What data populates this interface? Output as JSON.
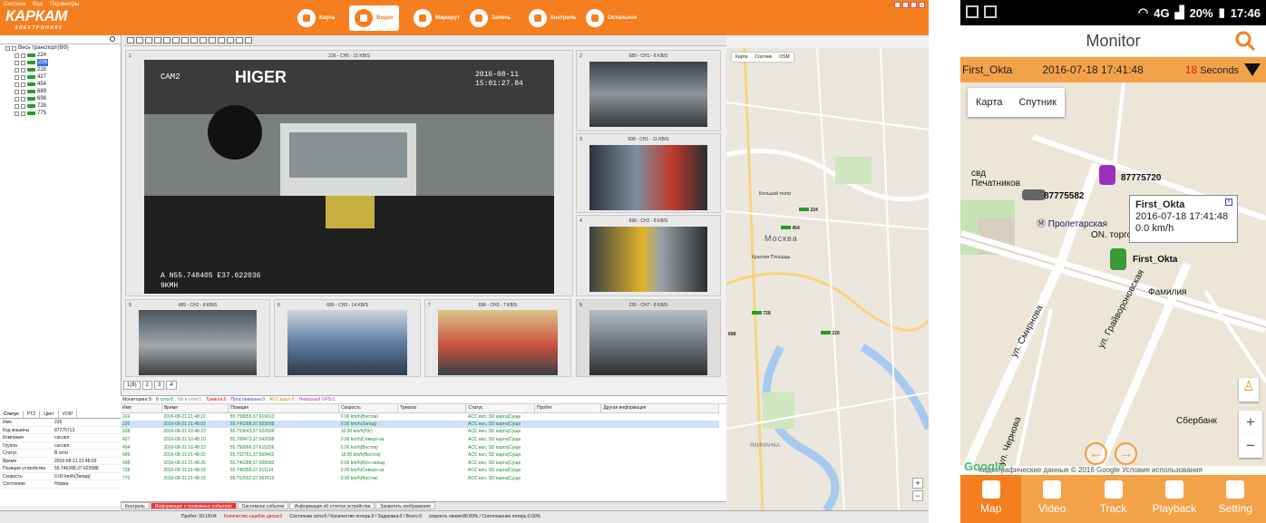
{
  "desktop": {
    "menu": [
      "Система",
      "Вид",
      "Параметры"
    ],
    "logo": {
      "main": "КАРКАМ",
      "sub": "ЭЛЕКТРОНИКС"
    },
    "nav": [
      {
        "label": "Карта"
      },
      {
        "label": "Видео"
      },
      {
        "label": "Маршрут"
      },
      {
        "label": "Запись"
      },
      {
        "label": "Контроль"
      },
      {
        "label": "Остальное"
      }
    ],
    "tree": {
      "root": "Весь транспорт(8/9)",
      "items": [
        "224",
        "226",
        "228",
        "427",
        "454",
        "689",
        "698",
        "728",
        "775"
      ]
    },
    "video_cells": [
      {
        "num": "1",
        "header": "226 - CH5 - 15 KB/S",
        "osd_cam": "CAM2",
        "osd_time": "2016-08-11\n15:01:27.84",
        "osd_gps": "A N55.748405  E37.622036\n9KMH",
        "brand": "HIGER"
      },
      {
        "num": "2",
        "header": "689 - CH1 - 8 KB/S"
      },
      {
        "num": "3",
        "header": "698 - CH1 - 11 KB/S"
      },
      {
        "num": "4",
        "header": "698 - CH2 - 8 KB/S"
      },
      {
        "num": "5",
        "header": "689 - CH2 - 8 KB/S"
      },
      {
        "num": "6",
        "header": "689 - CH3 - 14 KB/S"
      },
      {
        "num": "7",
        "header": "698 - CH3 - 7 KB/S"
      },
      {
        "num": "8",
        "header": "226 - CH7 - 8 KB/S"
      }
    ],
    "video_tabs": [
      "1(8)",
      "2",
      "3",
      "4"
    ],
    "map": {
      "tabs": [
        "Карта",
        "Спутник",
        "OSM"
      ],
      "labels": [
        "Москва",
        "Красная Площадь",
        "Большой театр",
        "ЯКИМАНКА"
      ],
      "vehicles": [
        "224",
        "454",
        "728",
        "698",
        "226"
      ]
    },
    "info_tabs": [
      "Статус",
      "PTZ",
      "Цвет",
      "VOIP"
    ],
    "info_rows": [
      {
        "k": "Имя",
        "v": "226"
      },
      {
        "k": "Код машины",
        "v": "87775713"
      },
      {
        "k": "Компания",
        "v": "carcam"
      },
      {
        "k": "Группа",
        "v": "carcam"
      },
      {
        "k": "Статус",
        "v": "В сети"
      },
      {
        "k": "Время",
        "v": "2016-08-21 21:48:03"
      },
      {
        "k": "Позиция устройства",
        "v": "55.746288,37.623588"
      },
      {
        "k": "Скорость",
        "v": "0.00 km/h(Запад)"
      },
      {
        "k": "Состояние",
        "v": "Норма"
      }
    ],
    "legend": [
      {
        "text": "Мониторинг:9",
        "color": "#222"
      },
      {
        "text": "В сети:8",
        "color": "#1b8d2d"
      },
      {
        "text": "Не в сети:1",
        "color": "#888"
      },
      {
        "text": "Тревога:0",
        "color": "#d00"
      },
      {
        "text": "Простаивание:0",
        "color": "#5a3ab8"
      },
      {
        "text": "ACC выкл:0",
        "color": "#c09000"
      },
      {
        "text": "Неверный GPS:0",
        "color": "#c030c0"
      }
    ],
    "table": {
      "columns": [
        "Имя",
        "Время",
        "Позиция",
        "Скорость",
        "Тревога",
        "Статус",
        "Пробег",
        "Другая информация"
      ],
      "rows": [
        [
          "224",
          "2016-08-21 21:48:22",
          "55.758655,37.619613",
          "0.00 km/h(Восток)",
          "",
          "ACC вкл, SD карта(Суще",
          "",
          ""
        ],
        [
          "226",
          "2016-08-21 21:48:03",
          "55.746288,37.623588",
          "0.00 km/h(Запад)",
          "",
          "ACC вкл, SD карта(Суще",
          "",
          ""
        ],
        [
          "228",
          "2016-08-21 16:48:23",
          "55.753643,37.622509",
          "10.00 km/h(Юг)",
          "",
          "ACC вкл, SD карта(Суще",
          "",
          ""
        ],
        [
          "427",
          "2016-08-21 16:48:10",
          "55.708473,37.542098",
          "0.00 km/h(Северо-за",
          "",
          "ACC вкл, SD карта(Суще",
          "",
          ""
        ],
        [
          "454",
          "2016-08-21 16:48:23",
          "55.756866,37.615226",
          "0.00 km/h(Восток)",
          "",
          "ACC вкл, SD карта(Суще",
          "",
          ""
        ],
        [
          "689",
          "2016-08-21 21:48:02",
          "55.752761,37.569462",
          "18.00 km/h(Восток)",
          "",
          "ACC вкл, SD карта(Суще",
          "",
          ""
        ],
        [
          "698",
          "2016-08-21 21:48:26",
          "55.746288,37.605583",
          "0.00 km/h(Юго-запад",
          "",
          "ACC вкл, SD карта(Суще",
          "",
          ""
        ],
        [
          "728",
          "2016-08-21 21:48:18",
          "55.748359,37.611114",
          "0.00 km/h(Северо-за",
          "",
          "ACC вкл, SD карта(Суще",
          "",
          ""
        ],
        [
          "775",
          "2016-08-21 21:48:15",
          "55.752552,37.567615",
          "9.00 km/h(Восток)",
          "",
          "ACC вкл, SD карта(Суще",
          "",
          ""
        ]
      ]
    },
    "bottom_tabs": [
      {
        "label": "Контроль",
        "alert": false
      },
      {
        "label": "Информация о тревожных событиях",
        "alert": true
      },
      {
        "label": "Системное событие",
        "alert": false
      },
      {
        "label": "Информация об отчетах устройства",
        "alert": false
      },
      {
        "label": "Захватить изображение",
        "alert": false
      }
    ],
    "statusbar": {
      "mileage": "Пробег: 00:18:04",
      "errors": "Количество ошибок диска:0",
      "network": "Состояние сети:8 / Количество потерь:0 / Задержка:0 / Всего:9",
      "speed": "скорость линии:88.89% / Соотношение потерь:0.00%"
    }
  },
  "phone": {
    "statusbar": {
      "network": "4G",
      "battery": "20%",
      "time": "17:46"
    },
    "title": "Monitor",
    "device": "First_Okta",
    "datetime": "2016-07-18 17:41:48",
    "interval_value": "18",
    "interval_unit": "Seconds",
    "map_tabs": [
      "Карта",
      "Спутник"
    ],
    "popup": {
      "name": "First_Okta",
      "time": "2016-07-18 17:41:48",
      "speed": "0.0 km/h"
    },
    "vehicles": [
      {
        "label": "87775720",
        "color": "#9b30b8"
      },
      {
        "label": "87775582",
        "color": "#666"
      },
      {
        "label": "First_Okta",
        "color": "#3a9a35"
      }
    ],
    "map_labels": [
      "свд Печатников",
      "Пролетарская",
      "ON. торговы",
      "Фамилия",
      "Сбербанк",
      "ул. Грайвороновская",
      "ул. Чернова",
      "ул. Смирнова"
    ],
    "google": "Google",
    "map_footer": "Картографические данные © 2016 Google   Условия использования",
    "nav": [
      {
        "label": "Map",
        "active": true
      },
      {
        "label": "Video",
        "active": false
      },
      {
        "label": "Track",
        "active": false
      },
      {
        "label": "Playback",
        "active": false
      },
      {
        "label": "Setting",
        "active": false
      }
    ]
  }
}
